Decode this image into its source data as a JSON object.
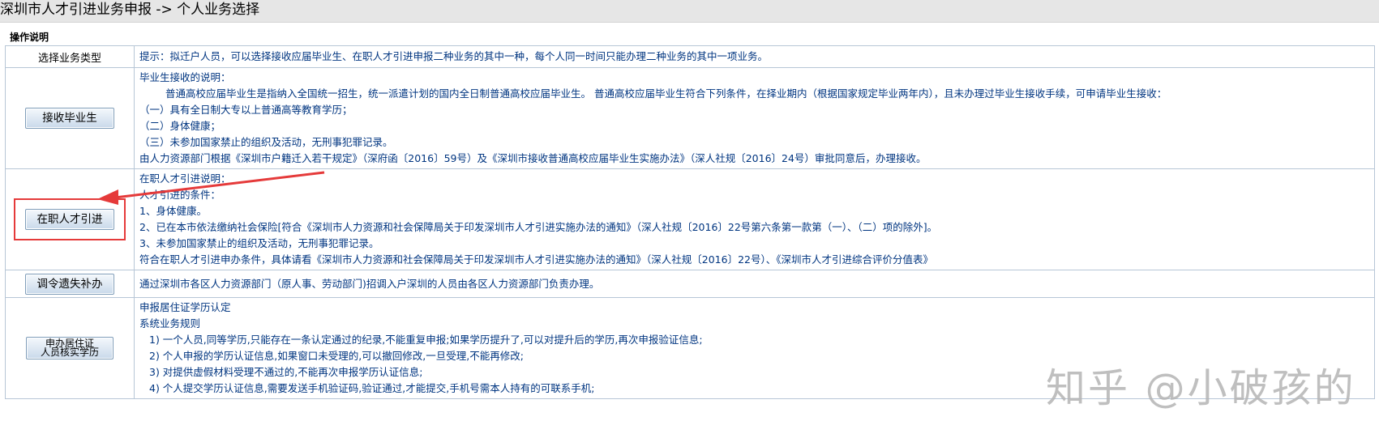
{
  "header": {
    "title": "深圳市人才引进业务申报 -> 个人业务选择"
  },
  "section_label": "操作说明",
  "rows": [
    {
      "left": "选择业务类型",
      "lines": [
        "提示：拟迁户人员，可以选择接收应届毕业生、在职人才引进申报二种业务的其中一种，每个人同一时间只能办理二种业务的其中一项业务。"
      ]
    },
    {
      "button": "接收毕业生",
      "lines": [
        "毕业生接收的说明：",
        "普通高校应届毕业生是指纳入全国统一招生，统一派遣计划的国内全日制普通高校应届毕业生。 普通高校应届毕业生符合下列条件，在择业期内（根据国家规定毕业两年内），且未办理过毕业生接收手续，可申请毕业生接收：",
        "（一）具有全日制大专以上普通高等教育学历；",
        "（二）身体健康；",
        "（三）未参加国家禁止的组织及活动，无刑事犯罪记录。",
        "由人力资源部门根据《深圳市户籍迁入若干规定》（深府函〔2016〕59号）及《深圳市接收普通高校应届毕业生实施办法》（深人社规〔2016〕24号）审批同意后，办理接收。"
      ]
    },
    {
      "button": "在职人才引进",
      "lines": [
        "在职人才引进说明：",
        "人才引进的条件：",
        "1、身体健康。",
        "2、已在本市依法缴纳社会保险[符合《深圳市人力资源和社会保障局关于印发深圳市人才引进实施办法的通知》（深人社规〔2016〕22号第六条第一款第（一）、（二）项的除外]。",
        "3、未参加国家禁止的组织及活动，无刑事犯罪记录。",
        "符合在职人才引进申办条件，具体请看《深圳市人力资源和社会保障局关于印发深圳市人才引进实施办法的通知》（深人社规〔2016〕22号）、《深圳市人才引进综合评价分值表》"
      ]
    },
    {
      "button": "调令遗失补办",
      "lines": [
        "通过深圳市各区人力资源部门（原人事、劳动部门)招调入户深圳的人员由各区人力资源部门负责办理。"
      ]
    },
    {
      "button_line1": "申办居住证",
      "button_line2": "人员核实学历",
      "lines": [
        "申报居住证学历认定",
        "系统业务规则",
        "1) 一个人员,同等学历,只能存在一条认定通过的纪录,不能重复申报;如果学历提升了,可以对提升后的学历,再次申报验证信息;",
        "2) 个人申报的学历认证信息,如果窗口未受理的,可以撤回修改,一旦受理,不能再修改;",
        "3) 对提供虚假材料受理不通过的,不能再次申报学历认证信息;",
        "4) 个人提交学历认证信息,需要发送手机验证码,验证通过,才能提交,手机号需本人持有的可联系手机;"
      ]
    }
  ],
  "watermark": "知乎 @小破孩的",
  "colors": {
    "annotation": "#e53a3a",
    "text_blue": "#003580",
    "border": "#b7c6d6"
  }
}
